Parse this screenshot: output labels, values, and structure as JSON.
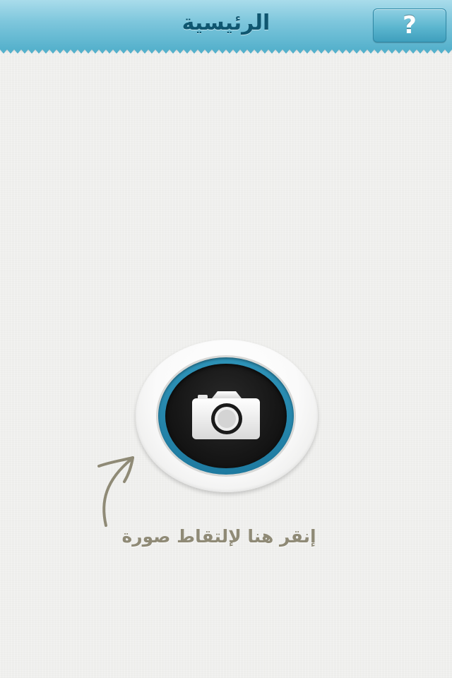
{
  "header": {
    "title": "الرئيسية",
    "help_label": "?",
    "accent_color": "#5cb6cf"
  },
  "main": {
    "camera_button": {
      "icon": "camera-icon",
      "ring_color": "#2e93b8"
    },
    "hint": {
      "text": "إنقر هنا لإلتقاط صورة",
      "icon": "curved-arrow-icon",
      "color": "#8f8a76"
    }
  }
}
